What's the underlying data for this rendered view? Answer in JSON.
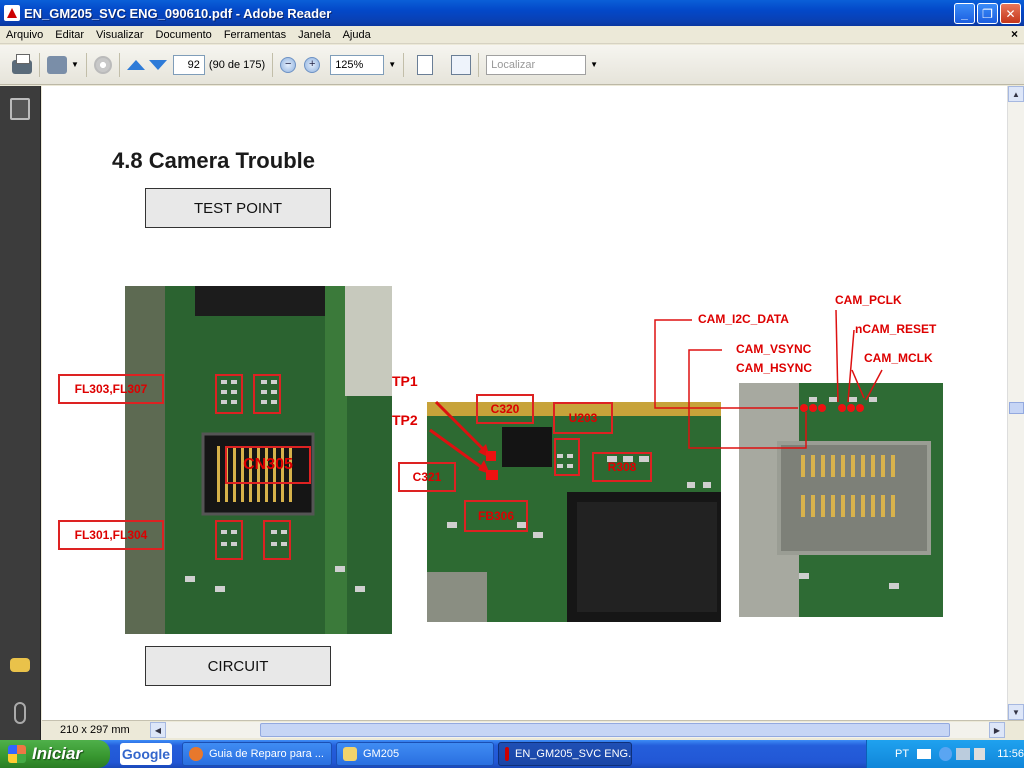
{
  "window": {
    "title": "EN_GM205_SVC ENG_090610.pdf - Adobe Reader",
    "minimize": "_",
    "maximize": "❐",
    "close": "✕"
  },
  "menu": {
    "items": [
      "Arquivo",
      "Editar",
      "Visualizar",
      "Documento",
      "Ferramentas",
      "Janela",
      "Ajuda"
    ],
    "close_doc": "×"
  },
  "toolbar": {
    "page_number": "92",
    "page_count": "(90 de 175)",
    "zoom_out": "−",
    "zoom_in": "+",
    "zoom_level": "125%",
    "search_placeholder": "Localizar"
  },
  "document": {
    "heading": "4.8 Camera Trouble",
    "test_point_label": "TEST POINT",
    "circuit_label": "CIRCUIT",
    "photo1_labels": {
      "fl303": "FL303,FL307",
      "fl301": "FL301,FL304",
      "cn305": "CN305"
    },
    "photo2_labels": {
      "tp1": "TP1",
      "tp2": "TP2",
      "c320": "C320",
      "u203": "U203",
      "c321": "C321",
      "r308": "R308",
      "fb306": "FB306"
    },
    "photo3_labels": {
      "cam_pclk": "CAM_PCLK",
      "cam_i2c_data": "CAM_I2C_DATA",
      "ncam_reset": "nCAM_RESET",
      "cam_vsync": "CAM_VSYNC",
      "cam_hsync": "CAM_HSYNC",
      "cam_mclk": "CAM_MCLK"
    }
  },
  "statusbar": {
    "page_size": "210 x 297 mm"
  },
  "taskbar": {
    "start_label": "Iniciar",
    "google_label": "Google",
    "tasks": [
      "Guia de Reparo para ...",
      "GM205",
      "EN_GM205_SVC ENG..."
    ],
    "language": "PT",
    "clock": "11:56"
  },
  "colors": {
    "annotation_red": "#dd1111",
    "pcb_green": "#2d6a32",
    "xp_blue": "#245edb"
  }
}
